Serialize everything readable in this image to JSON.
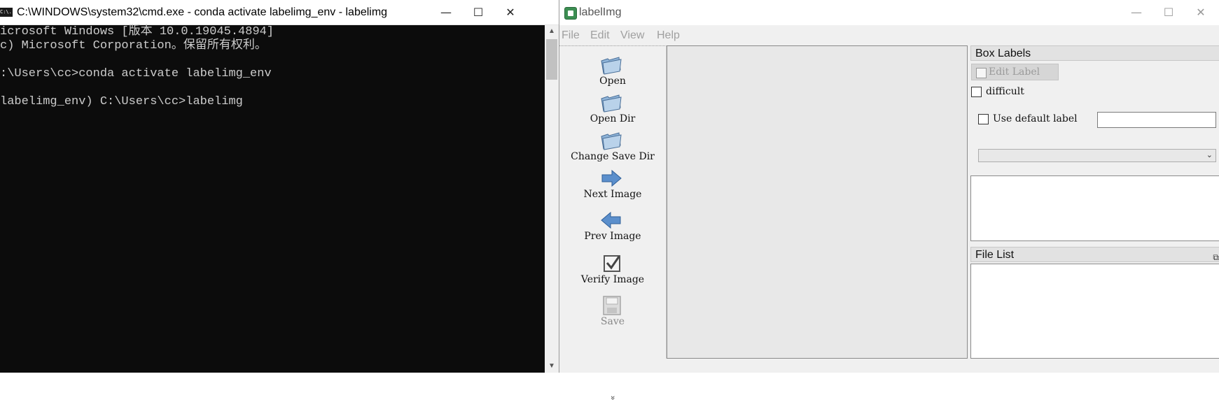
{
  "cmd": {
    "title": "C:\\WINDOWS\\system32\\cmd.exe - conda  activate labelimg_env - labelimg",
    "icon_text": "C:\\.",
    "controls": {
      "minimize": "—",
      "maximize": "☐",
      "close": "✕"
    },
    "lines": [
      "icrosoft Windows [版本 10.0.19045.4894]",
      "c) Microsoft Corporation。保留所有权利。",
      "",
      ":\\Users\\cc>conda activate labelimg_env",
      "",
      "labelimg_env) C:\\Users\\cc>labelimg"
    ],
    "scroll_up": "▲",
    "scroll_down": "▼"
  },
  "labelimg": {
    "title": "labelImg",
    "controls": {
      "minimize": "—",
      "maximize": "☐",
      "close": "✕"
    },
    "menu": [
      "File",
      "Edit",
      "View",
      "Help"
    ],
    "tools": [
      {
        "label": "Open",
        "icon": "folder-open-icon",
        "enabled": true
      },
      {
        "label": "Open Dir",
        "icon": "folder-open-icon",
        "enabled": true
      },
      {
        "label": "Change Save Dir",
        "icon": "folder-open-icon",
        "enabled": true
      },
      {
        "label": "Next Image",
        "icon": "arrow-right-icon",
        "enabled": true
      },
      {
        "label": "Prev Image",
        "icon": "arrow-left-icon",
        "enabled": true
      },
      {
        "label": "Verify Image",
        "icon": "checkbox-icon",
        "enabled": true
      },
      {
        "label": "Save",
        "icon": "floppy-disk-icon",
        "enabled": false
      }
    ],
    "more_tools": "»",
    "box_labels": {
      "title": "Box Labels",
      "edit_label": "Edit Label",
      "difficult": "difficult",
      "use_default_label": "Use default label",
      "default_label_value": ""
    },
    "file_list": {
      "title": "File List",
      "float_icon": "⧉"
    },
    "colors": {
      "folder": "#8fb4d8",
      "arrow": "#4f86c6",
      "check": "#555555"
    }
  }
}
